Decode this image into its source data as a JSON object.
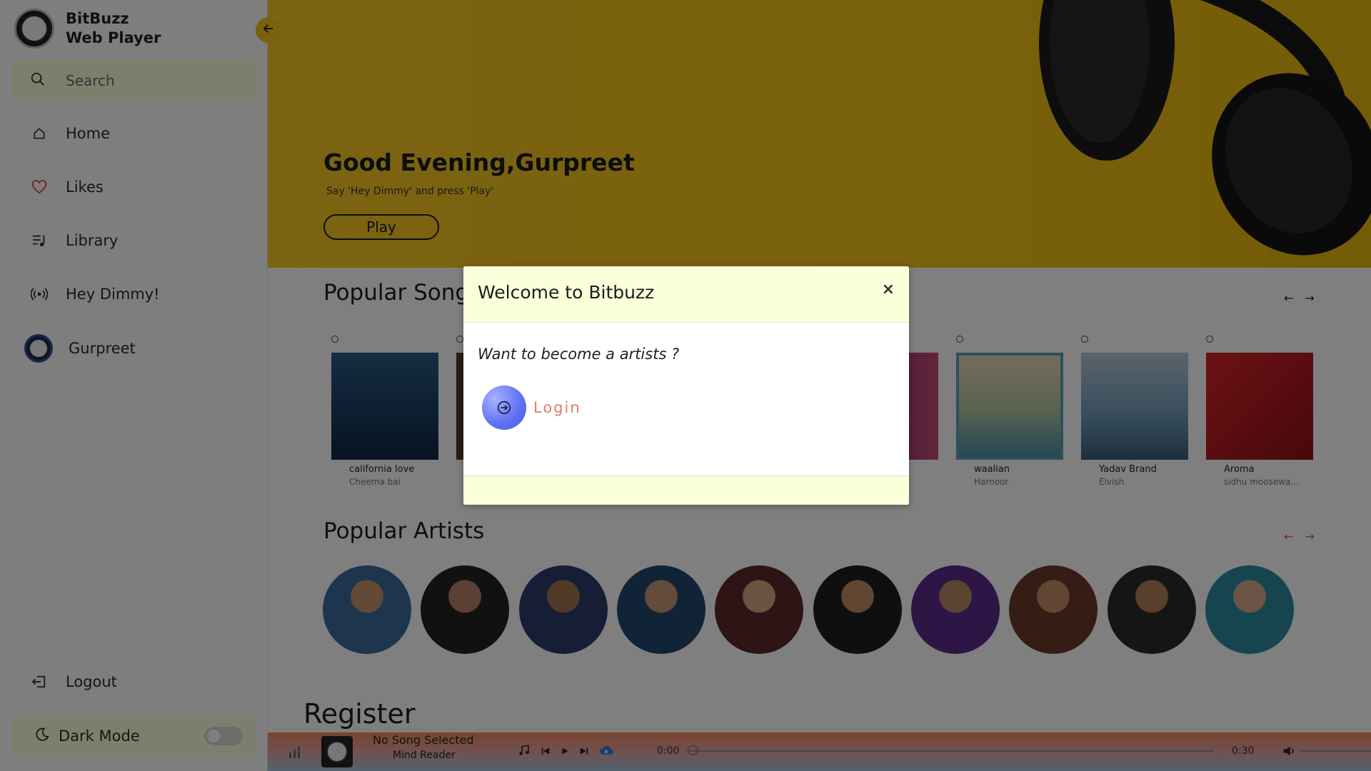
{
  "sidebar": {
    "brand": {
      "line1": "BitBuzz",
      "line2": "Web Player"
    },
    "search": {
      "placeholder": "Search"
    },
    "nav": [
      {
        "label": "Home",
        "icon": "home-icon"
      },
      {
        "label": "Likes",
        "icon": "heart-icon"
      },
      {
        "label": "Library",
        "icon": "playlist-icon"
      },
      {
        "label": "Hey Dimmy!",
        "icon": "broadcast-icon"
      },
      {
        "label": "Gurpreet",
        "icon": "avatar"
      }
    ],
    "logout": "Logout",
    "dark_mode": "Dark Mode"
  },
  "hero": {
    "title": "Good Evening,Gurpreet",
    "subtitle": "Say 'Hey Dimmy' and press 'Play'",
    "play_label": "Play"
  },
  "popular_songs": {
    "title": "Popular Songs",
    "items": [
      {
        "title": "california love",
        "artist": "Cheema bai"
      },
      {
        "title": "",
        "artist": ""
      },
      {
        "title": "",
        "artist": ""
      },
      {
        "title": "",
        "artist": ""
      },
      {
        "title": "",
        "artist": ""
      },
      {
        "title": "waalian",
        "artist": "Harnoor"
      },
      {
        "title": "Yadav Brand",
        "artist": "Elvish"
      },
      {
        "title": "Aroma",
        "artist": "sidhu moosewa..."
      }
    ]
  },
  "popular_artists": {
    "title": "Popular Artists"
  },
  "register": {
    "title": "Register"
  },
  "player": {
    "song": "No Song Selected",
    "artist": "Mind Reader",
    "current_time": "0:00",
    "total_time": "0:30",
    "progress": 0
  },
  "modal": {
    "title": "Welcome to Bitbuzz",
    "close": "×",
    "question": "Want to become a artists ?",
    "login_label": "Login"
  },
  "colors": {
    "accent_yellow": "#f2c21a",
    "panel_cream": "#fbffda",
    "login_blue": "#5e6ff2",
    "login_text": "#e07b6c"
  }
}
